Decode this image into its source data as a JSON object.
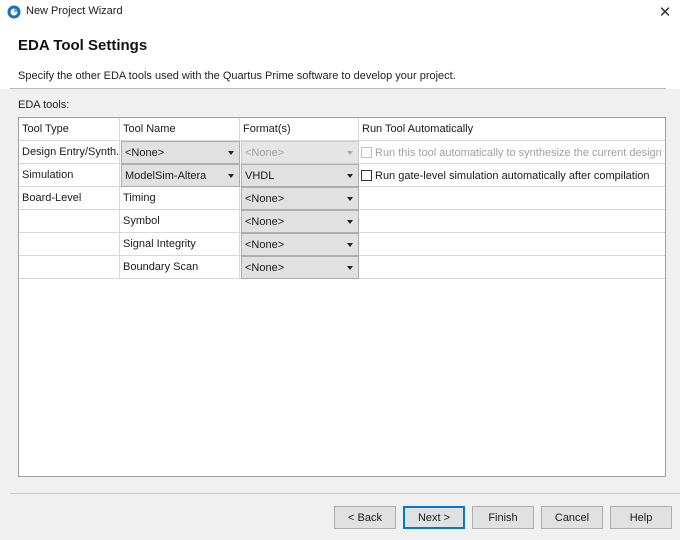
{
  "window": {
    "title": "New Project Wizard",
    "icon": "quartus-app-icon"
  },
  "header": {
    "title": "EDA Tool Settings",
    "description": "Specify the other EDA tools used with the Quartus Prime software to develop your project."
  },
  "section_label": "EDA tools:",
  "table": {
    "columns": [
      "Tool Type",
      "Tool Name",
      "Format(s)",
      "Run Tool Automatically"
    ],
    "rows": [
      {
        "type": "Design Entry/Synth...",
        "tool": "<None>",
        "format": "<None>",
        "run_label": "Run this tool automatically to synthesize the current design",
        "checked": false,
        "disabled": true
      },
      {
        "type": "Simulation",
        "tool": "ModelSim-Altera",
        "format": "VHDL",
        "run_label": "Run gate-level simulation automatically after compilation",
        "checked": false,
        "disabled": false
      },
      {
        "type": "Board-Level",
        "tool": "Timing",
        "format": "<None>"
      },
      {
        "type": "",
        "tool": "Symbol",
        "format": "<None>"
      },
      {
        "type": "",
        "tool": "Signal Integrity",
        "format": "<None>"
      },
      {
        "type": "",
        "tool": "Boundary Scan",
        "format": "<None>"
      }
    ]
  },
  "buttons": {
    "back": "< Back",
    "next": "Next >",
    "finish": "Finish",
    "cancel": "Cancel",
    "help": "Help"
  },
  "colors": {
    "accent": "#0078d7",
    "dialog_bg": "#f0f0f0",
    "combo_bg": "#e1e1e1"
  }
}
